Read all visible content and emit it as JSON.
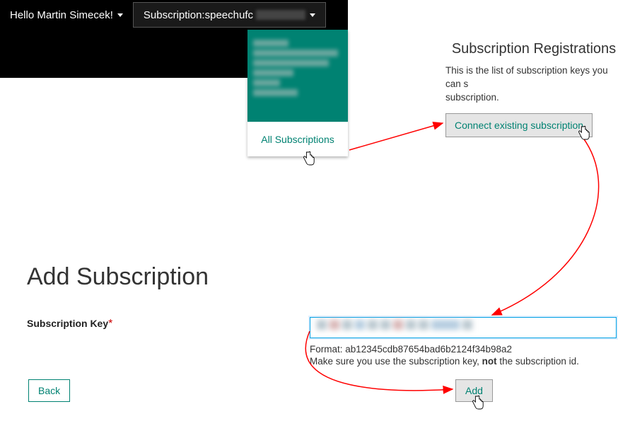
{
  "topbar": {
    "greeting": "Hello Martin Simecek!",
    "subscription_prefix": "Subscription: ",
    "subscription_name": "speechufc"
  },
  "dropdown": {
    "all_subscriptions": "All Subscriptions"
  },
  "side": {
    "title": "Subscription Registrations",
    "desc_line": "This is the list of subscription keys you can s",
    "desc_line2": "subscription.",
    "connect_btn": "Connect existing subscription"
  },
  "add_sub": {
    "title": "Add Subscription",
    "field_label": "Subscription Key",
    "required": "*",
    "format_label": "Format: ",
    "format_value": "ab12345cdb87654bad6b2124f34b98a2",
    "hint_pre": "Make sure you use the subscription key, ",
    "hint_not": "not",
    "hint_post": " the subscription id.",
    "back_btn": "Back",
    "add_btn": "Add"
  }
}
